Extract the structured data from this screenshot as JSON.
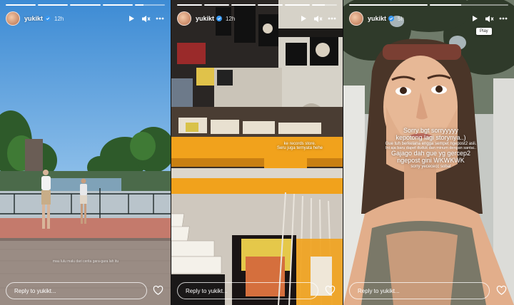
{
  "stories": [
    {
      "username": "yukikt",
      "time": "12h",
      "progress": [
        1,
        1,
        1,
        1,
        0.3
      ],
      "caption_small": "mau lulu malu dari cerita gara-gara lah itu",
      "reply_placeholder": "Reply to yukikt..."
    },
    {
      "username": "yukikt",
      "time": "12h",
      "progress": [
        1,
        1,
        1,
        1,
        1,
        0.5
      ],
      "caption_line1": "ke records store.",
      "caption_line2": "Seru juga ternyata hehe",
      "reply_placeholder": "Reply to yukikt..."
    },
    {
      "username": "yukikt",
      "time": "5h",
      "progress": [
        1,
        0.4
      ],
      "caption_lines": [
        "Sorry bgt sorryyyyy",
        "kepotong lagi storynya..)",
        "Gue tuh berkelana engga sempet ngepost2 asli.",
        "Ini aja baru dapet duduk dan minum dengan santai..",
        "Gajago dah gue yg gercep2",
        "ngepost gini WKWKWK",
        "sorry yecececc sobat"
      ],
      "tooltip": "Play",
      "reply_placeholder": "Reply to yukikt..."
    }
  ],
  "colors": {
    "verified": "#3897f0",
    "reply_border": "#ffffff"
  },
  "icons": [
    "verified-icon",
    "play-icon",
    "mute-icon",
    "more-icon",
    "heart-icon"
  ]
}
